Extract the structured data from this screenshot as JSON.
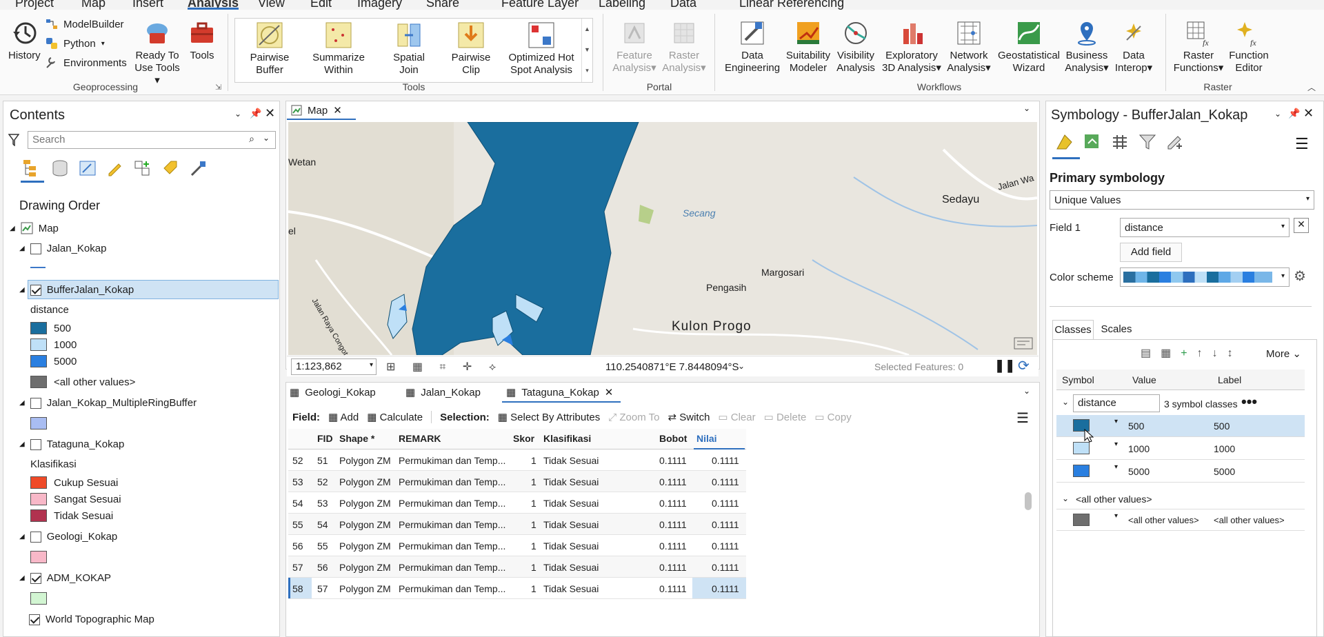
{
  "ribbon": {
    "tabs": [
      "Project",
      "Map",
      "Insert",
      "Analysis",
      "View",
      "Edit",
      "Imagery",
      "Share",
      "Feature Layer",
      "Labeling",
      "Data",
      "Linear Referencing"
    ],
    "active_tab": "Analysis",
    "geoprocessing": {
      "history": "History",
      "modelbuilder": "ModelBuilder",
      "python": "Python",
      "environments": "Environments",
      "ready1": "Ready To",
      "ready2": "Use Tools",
      "tools": "Tools",
      "group": "Geoprocessing"
    },
    "tools_gallery": [
      {
        "l1": "Pairwise",
        "l2": "Buffer"
      },
      {
        "l1": "Summarize",
        "l2": "Within"
      },
      {
        "l1": "Spatial",
        "l2": "Join"
      },
      {
        "l1": "Pairwise",
        "l2": "Clip"
      },
      {
        "l1": "Optimized Hot",
        "l2": "Spot Analysis"
      }
    ],
    "tools_group": "Tools",
    "portal": [
      {
        "l1": "Feature",
        "l2": "Analysis"
      },
      {
        "l1": "Raster",
        "l2": "Analysis"
      }
    ],
    "portal_group": "Portal",
    "workflows": [
      {
        "l1": "Data",
        "l2": "Engineering"
      },
      {
        "l1": "Suitability",
        "l2": "Modeler"
      },
      {
        "l1": "Visibility",
        "l2": "Analysis"
      },
      {
        "l1": "Exploratory",
        "l2": "3D Analysis"
      },
      {
        "l1": "Network",
        "l2": "Analysis"
      },
      {
        "l1": "Geostatistical",
        "l2": "Wizard"
      },
      {
        "l1": "Business",
        "l2": "Analysis"
      },
      {
        "l1": "Data",
        "l2": "Interop"
      }
    ],
    "workflows_group": "Workflows",
    "raster": [
      {
        "l1": "Raster",
        "l2": "Functions"
      },
      {
        "l1": "Function",
        "l2": "Editor"
      }
    ],
    "raster_group": "Raster"
  },
  "contents": {
    "title": "Contents",
    "search_placeholder": "Search",
    "drawing_order": "Drawing Order",
    "map": "Map",
    "layers": {
      "jalan": "Jalan_Kokap",
      "buffer": "BufferJalan_Kokap",
      "buffer_field": "distance",
      "buffer_classes": [
        "500",
        "1000",
        "5000",
        "<all other values>"
      ],
      "ring": "Jalan_Kokap_MultipleRingBuffer",
      "tataguna": "Tataguna_Kokap",
      "tataguna_field": "Klasifikasi",
      "tataguna_classes": [
        "Cukup Sesuai",
        "Sangat Sesuai",
        "Tidak Sesuai"
      ],
      "geologi": "Geologi_Kokap",
      "adm": "ADM_KOKAP",
      "world": "World Topographic Map"
    }
  },
  "map": {
    "tab": "Map",
    "scale": "1:123,862",
    "coords": "110.2540871°E 7.8448094°S",
    "selected": "Selected Features: 0",
    "labels": {
      "wetan": "Wetan",
      "el": "el",
      "secang": "Secang",
      "sedayu": "Sedayu",
      "jalanwa": "Jalan Wa",
      "margosari": "Margosari",
      "pengasih": "Pengasih",
      "kulonprogo": "Kulon Progo",
      "raya": "Jalan Raya Congot"
    }
  },
  "table": {
    "tabs": [
      "Geologi_Kokap",
      "Jalan_Kokap",
      "Tataguna_Kokap"
    ],
    "toolbar": {
      "field": "Field:",
      "add": "Add",
      "calculate": "Calculate",
      "selection": "Selection:",
      "select_by": "Select By Attributes",
      "zoom": "Zoom To",
      "switch": "Switch",
      "clear": "Clear",
      "delete": "Delete",
      "copy": "Copy"
    },
    "columns": [
      "FID",
      "Shape *",
      "REMARK",
      "Skor",
      "Klasifikasi",
      "Bobot",
      "Nilai"
    ],
    "rows": [
      {
        "n": "52",
        "fid": "51",
        "shape": "Polygon ZM",
        "remark": "Permukiman dan Temp...",
        "skor": "1",
        "klas": "Tidak Sesuai",
        "bobot": "0.1111",
        "nilai": "0.1111"
      },
      {
        "n": "53",
        "fid": "52",
        "shape": "Polygon ZM",
        "remark": "Permukiman dan Temp...",
        "skor": "1",
        "klas": "Tidak Sesuai",
        "bobot": "0.1111",
        "nilai": "0.1111"
      },
      {
        "n": "54",
        "fid": "53",
        "shape": "Polygon ZM",
        "remark": "Permukiman dan Temp...",
        "skor": "1",
        "klas": "Tidak Sesuai",
        "bobot": "0.1111",
        "nilai": "0.1111"
      },
      {
        "n": "55",
        "fid": "54",
        "shape": "Polygon ZM",
        "remark": "Permukiman dan Temp...",
        "skor": "1",
        "klas": "Tidak Sesuai",
        "bobot": "0.1111",
        "nilai": "0.1111"
      },
      {
        "n": "56",
        "fid": "55",
        "shape": "Polygon ZM",
        "remark": "Permukiman dan Temp...",
        "skor": "1",
        "klas": "Tidak Sesuai",
        "bobot": "0.1111",
        "nilai": "0.1111"
      },
      {
        "n": "57",
        "fid": "56",
        "shape": "Polygon ZM",
        "remark": "Permukiman dan Temp...",
        "skor": "1",
        "klas": "Tidak Sesuai",
        "bobot": "0.1111",
        "nilai": "0.1111"
      },
      {
        "n": "58",
        "fid": "57",
        "shape": "Polygon ZM",
        "remark": "Permukiman dan Temp...",
        "skor": "1",
        "klas": "Tidak Sesuai",
        "bobot": "0.1111",
        "nilai": "0.1111"
      }
    ]
  },
  "symbology": {
    "title": "Symbology - BufferJalan_Kokap",
    "primary": "Primary symbology",
    "method": "Unique Values",
    "field1_label": "Field 1",
    "field1": "distance",
    "add_field": "Add field",
    "color_scheme": "Color scheme",
    "tab_classes": "Classes",
    "tab_scales": "Scales",
    "more": "More",
    "cols": [
      "Symbol",
      "Value",
      "Label"
    ],
    "group": "distance",
    "group_count": "3 symbol classes",
    "classes": [
      {
        "value": "500",
        "label": "500"
      },
      {
        "value": "1000",
        "label": "1000"
      },
      {
        "value": "5000",
        "label": "5000"
      }
    ],
    "other_group": "<all other values>",
    "other_value": "<all other values>",
    "other_label": "<all other values>"
  },
  "colors": {
    "c500": "#1a6e9e",
    "c1000": "#bfe0f7",
    "c5000": "#2a7fe0",
    "other": "#6e6e6e",
    "cukup": "#ef4a28",
    "sangat": "#f8b8c8",
    "tidak": "#b1324f",
    "ring": "#a9bdf2",
    "geologi": "#f8b8c8",
    "adm": "#d2f5d2",
    "accent": "#2e6fbe"
  }
}
